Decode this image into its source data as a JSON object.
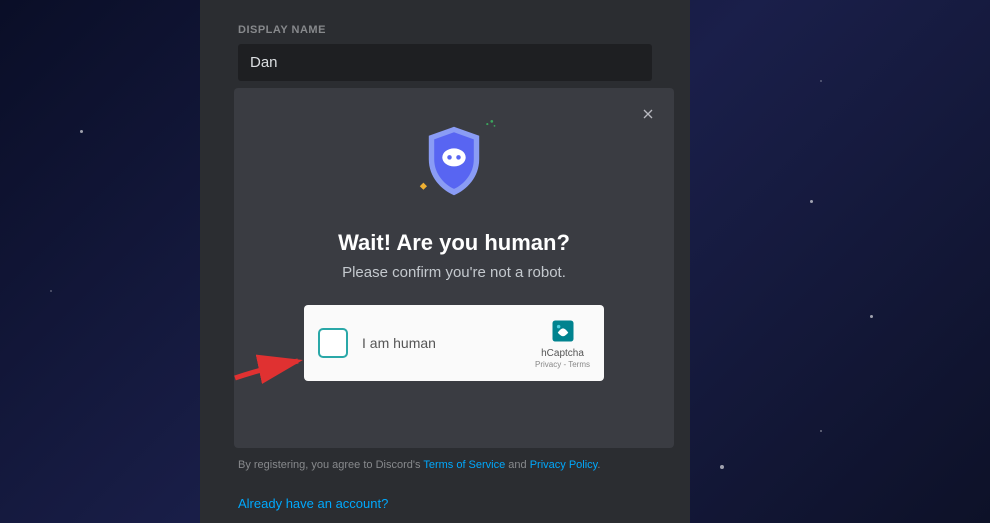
{
  "form": {
    "displayNameLabel": "DISPLAY NAME",
    "displayNameValue": "Dan"
  },
  "modal": {
    "title": "Wait! Are you human?",
    "subtitle": "Please confirm you're not a robot."
  },
  "captcha": {
    "label": "I am human",
    "brand": "hCaptcha",
    "links": "Privacy - Terms"
  },
  "footer": {
    "prefix": "By registering, you agree to Discord's ",
    "tos": "Terms of Service",
    "and": " and ",
    "privacy": "Privacy Policy",
    "alreadyAccount": "Already have an account?"
  }
}
